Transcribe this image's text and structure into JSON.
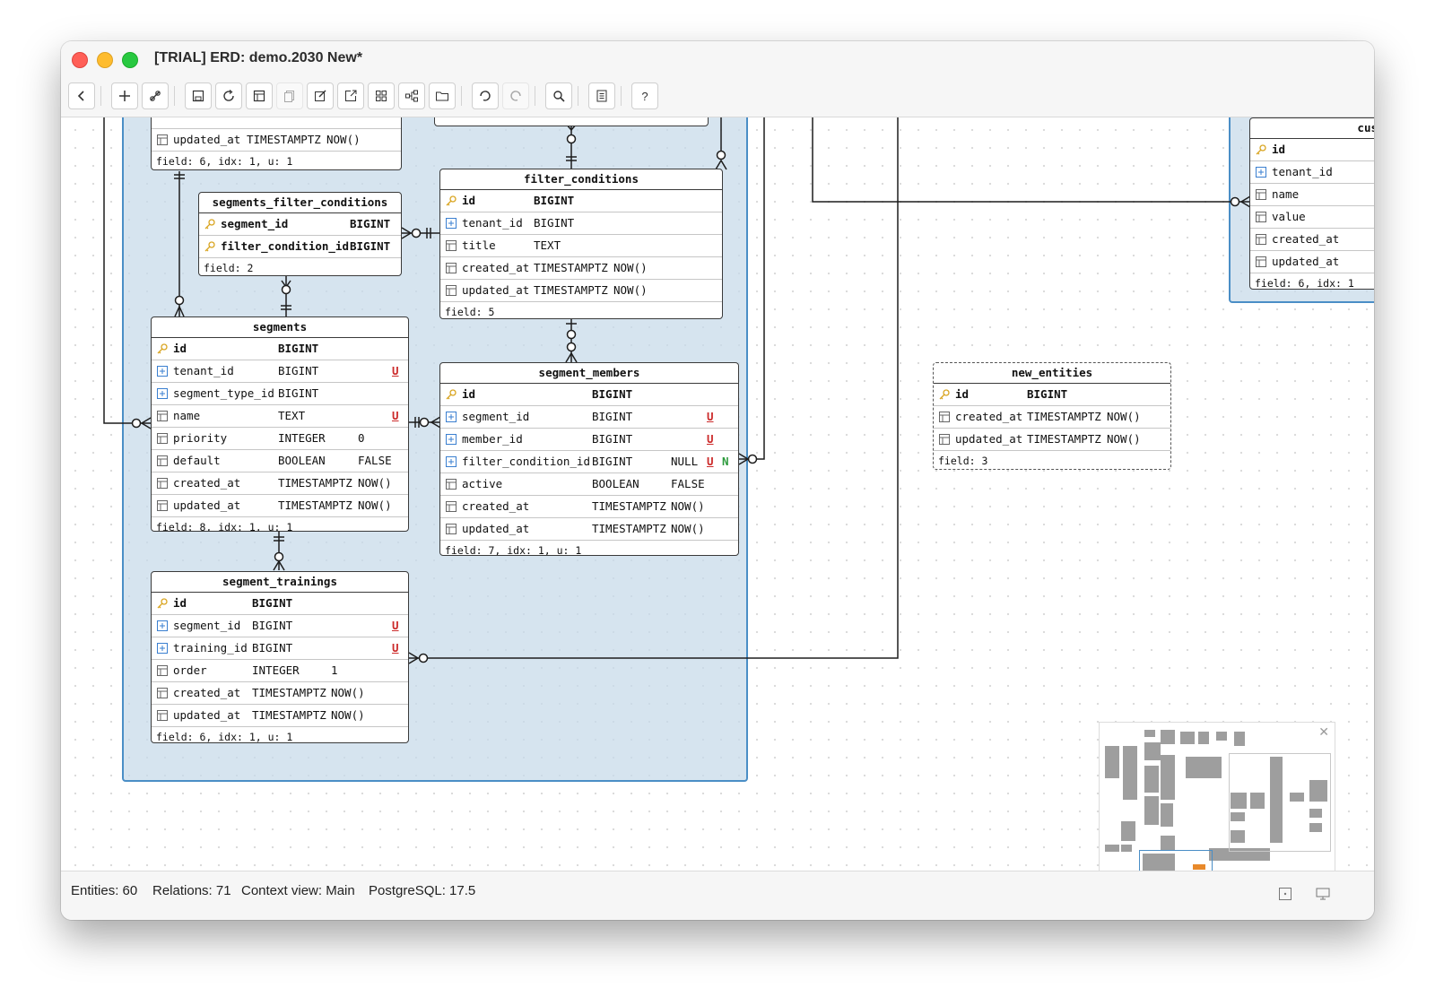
{
  "window": {
    "title": "[TRIAL] ERD: demo.2030 New*"
  },
  "toolbar": {
    "buttons": [
      "back",
      "add",
      "link",
      "save",
      "refresh",
      "layout",
      "copy",
      "edit",
      "export",
      "grid",
      "graph",
      "open",
      "undo",
      "redo",
      "search",
      "notes",
      "help"
    ]
  },
  "tables": {
    "top_partial": {
      "rows": [
        {
          "name": "updated_at",
          "type": "TIMESTAMPTZ",
          "default": "NOW()"
        }
      ],
      "footer": "field: 6, idx: 1, u: 1"
    },
    "segments_filter_conditions": {
      "title": "segments_filter_conditions",
      "rows": [
        {
          "name": "segment_id",
          "type": "BIGINT"
        },
        {
          "name": "filter_condition_id",
          "type": "BIGINT"
        }
      ],
      "footer": "field: 2"
    },
    "filter_conditions": {
      "title": "filter_conditions",
      "rows": [
        {
          "name": "id",
          "type": "BIGINT"
        },
        {
          "name": "tenant_id",
          "type": "BIGINT"
        },
        {
          "name": "title",
          "type": "TEXT"
        },
        {
          "name": "created_at",
          "type": "TIMESTAMPTZ",
          "default": "NOW()"
        },
        {
          "name": "updated_at",
          "type": "TIMESTAMPTZ",
          "default": "NOW()"
        }
      ],
      "footer": "field: 5"
    },
    "segments": {
      "title": "segments",
      "rows": [
        {
          "name": "id",
          "type": "BIGINT"
        },
        {
          "name": "tenant_id",
          "type": "BIGINT",
          "u": "U"
        },
        {
          "name": "segment_type_id",
          "type": "BIGINT"
        },
        {
          "name": "name",
          "type": "TEXT",
          "u": "U"
        },
        {
          "name": "priority",
          "type": "INTEGER",
          "default": "0"
        },
        {
          "name": "default",
          "type": "BOOLEAN",
          "default": "FALSE"
        },
        {
          "name": "created_at",
          "type": "TIMESTAMPTZ",
          "default": "NOW()"
        },
        {
          "name": "updated_at",
          "type": "TIMESTAMPTZ",
          "default": "NOW()"
        }
      ],
      "footer": "field: 8, idx: 1, u: 1"
    },
    "segment_members": {
      "title": "segment_members",
      "rows": [
        {
          "name": "id",
          "type": "BIGINT"
        },
        {
          "name": "segment_id",
          "type": "BIGINT",
          "u": "U"
        },
        {
          "name": "member_id",
          "type": "BIGINT",
          "u": "U"
        },
        {
          "name": "filter_condition_id",
          "type": "BIGINT",
          "default": "NULL",
          "u": "U",
          "n": "N"
        },
        {
          "name": "active",
          "type": "BOOLEAN",
          "default": "FALSE"
        },
        {
          "name": "created_at",
          "type": "TIMESTAMPTZ",
          "default": "NOW()"
        },
        {
          "name": "updated_at",
          "type": "TIMESTAMPTZ",
          "default": "NOW()"
        }
      ],
      "footer": "field: 7, idx: 1, u: 1"
    },
    "segment_trainings": {
      "title": "segment_trainings",
      "rows": [
        {
          "name": "id",
          "type": "BIGINT"
        },
        {
          "name": "segment_id",
          "type": "BIGINT",
          "u": "U"
        },
        {
          "name": "training_id",
          "type": "BIGINT",
          "u": "U"
        },
        {
          "name": "order",
          "type": "INTEGER",
          "default": "1"
        },
        {
          "name": "created_at",
          "type": "TIMESTAMPTZ",
          "default": "NOW()"
        },
        {
          "name": "updated_at",
          "type": "TIMESTAMPTZ",
          "default": "NOW()"
        }
      ],
      "footer": "field: 6, idx: 1, u: 1"
    },
    "new_entities": {
      "title": "new_entities",
      "rows": [
        {
          "name": "id",
          "type": "BIGINT"
        },
        {
          "name": "created_at",
          "type": "TIMESTAMPTZ",
          "default": "NOW()"
        },
        {
          "name": "updated_at",
          "type": "TIMESTAMPTZ",
          "default": "NOW()"
        }
      ],
      "footer": "field: 3"
    },
    "cus_partial": {
      "title": "cus",
      "rows": [
        {
          "name": "id",
          "type": ""
        },
        {
          "name": "tenant_id",
          "type": ""
        },
        {
          "name": "name",
          "type": ""
        },
        {
          "name": "value",
          "type": ""
        },
        {
          "name": "created_at",
          "type": ""
        },
        {
          "name": "updated_at",
          "type": ""
        }
      ],
      "footer": "field: 6, idx: 1"
    }
  },
  "statusbar": {
    "entities": "Entities: 60",
    "relations": "Relations: 71",
    "context": "Context view: Main",
    "db": "PostgreSQL: 17.5"
  },
  "colors": {
    "group_border": "#4a8ec6",
    "group_fill": "#c6dae9",
    "unique": "#cc2b2b",
    "nullable": "#2c9a3c",
    "minimap_highlight": "#e8892b"
  }
}
